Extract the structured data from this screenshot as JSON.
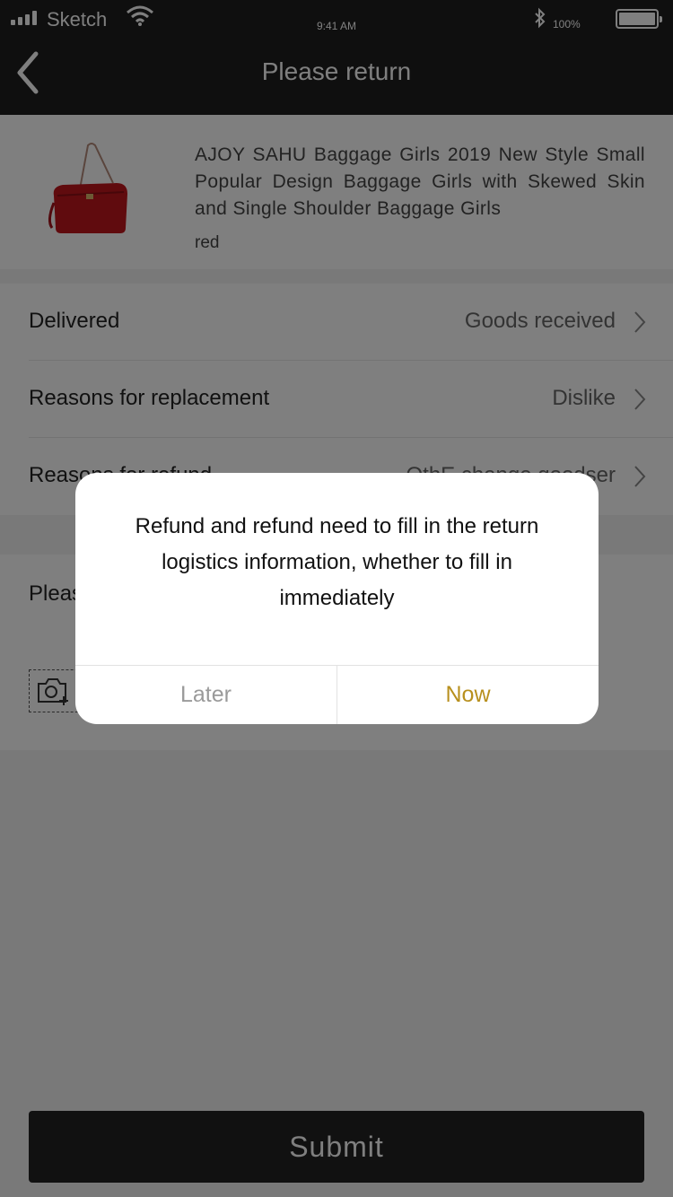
{
  "status_bar": {
    "carrier": "Sketch",
    "time": "9:41 AM",
    "battery": "100%"
  },
  "nav": {
    "title": "Please return"
  },
  "product": {
    "title": "AJOY SAHU Baggage Girls 2019 New Style Small Popular Design Baggage Girls with Skewed Skin and Single Shoulder Baggage Girls",
    "color": "red"
  },
  "rows": [
    {
      "label": "Delivered",
      "value": "Goods received"
    },
    {
      "label": "Reasons for replacement",
      "value": "Dislike"
    },
    {
      "label": "Reasons for refund",
      "value": "OthE change goodser"
    }
  ],
  "upload": {
    "hint": "Please"
  },
  "submit_label": "Submit",
  "dialog": {
    "message": "Refund and refund need to fill in the return logistics information, whether to fill in immediately",
    "later_label": "Later",
    "now_label": "Now"
  },
  "colors": {
    "nav_bg": "#1e1e1e",
    "accent": "#b8901e",
    "bag": "#c0161c"
  }
}
